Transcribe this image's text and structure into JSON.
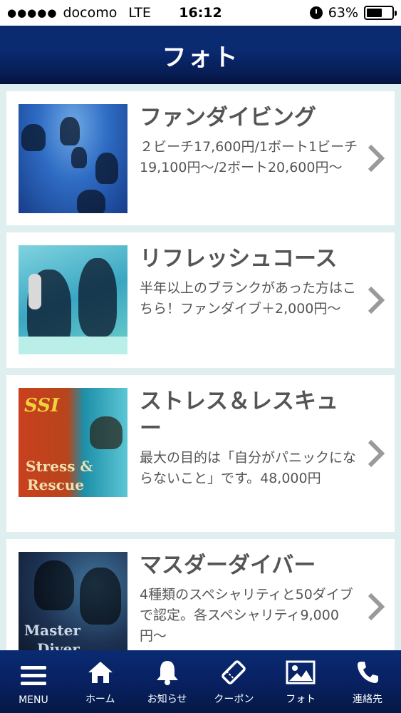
{
  "status_bar": {
    "signal": "●●●●●",
    "carrier": "docomo",
    "network": "LTE",
    "time": "16:12",
    "battery_percent": "63%",
    "battery_level": 0.63
  },
  "header": {
    "title": "フォト"
  },
  "colors": {
    "header_bg": "#0a2a73",
    "tab_bar_bg": "#082162",
    "list_bg": "#dfeff0",
    "card_text": "#555555"
  },
  "items": [
    {
      "title": "ファンダイビング",
      "description": "２ビーチ17,600円/1ボート1ビーチ19,100円〜/2ボート20,600円〜"
    },
    {
      "title": "リフレッシュコース",
      "description": "半年以上のブランクがあった方はこちら！ファンダイブ＋2,000円〜"
    },
    {
      "title": "ストレス＆レスキュー",
      "description": "最大の目的は「自分がパニックにならないこと」です。48,000円"
    },
    {
      "title": "マスダーダイバー",
      "description": "4種類のスペシャリティと50ダイブで認定。各スペシャリティ9,000円〜"
    }
  ],
  "thumb_text": {
    "ssi": "SSI",
    "stress": "Stress &",
    "rescue": "Rescue",
    "master": "Master",
    "diver": "Diver"
  },
  "tabs": [
    {
      "label": "MENU",
      "icon": "menu-icon"
    },
    {
      "label": "ホーム",
      "icon": "home-icon"
    },
    {
      "label": "お知らせ",
      "icon": "bell-icon"
    },
    {
      "label": "クーポン",
      "icon": "coupon-icon"
    },
    {
      "label": "フォト",
      "icon": "photo-icon"
    },
    {
      "label": "連絡先",
      "icon": "phone-icon"
    }
  ]
}
